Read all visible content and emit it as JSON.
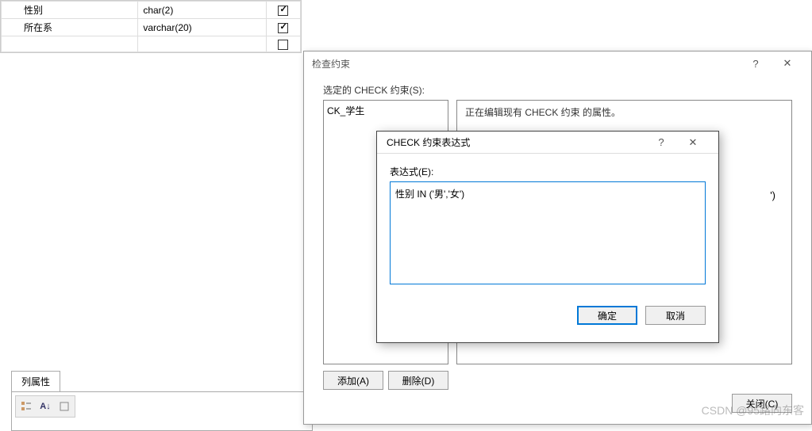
{
  "table": {
    "rows": [
      {
        "name": "性别",
        "type": "char(2)",
        "allowNull": true
      },
      {
        "name": "所在系",
        "type": "varchar(20)",
        "allowNull": true
      },
      {
        "name": "",
        "type": "",
        "allowNull": false
      }
    ]
  },
  "colProps": {
    "tab": "列属性"
  },
  "mainDialog": {
    "title": "检查约束",
    "help": "?",
    "close": "✕",
    "selectedLabel": "选定的 CHECK 约束(S):",
    "listItem": "CK_学生",
    "rightHint": "正在编辑现有 CHECK 约束 的属性。",
    "identityHint": "')",
    "addBtn": "添加(A)",
    "deleteBtn": "删除(D)",
    "closeBtn": "关闭(C)"
  },
  "exprDialog": {
    "title": "CHECK 约束表达式",
    "help": "?",
    "close": "✕",
    "label": "表达式(E):",
    "value": "性别 IN ('男','女')",
    "okBtn": "确定",
    "cancelBtn": "取消"
  },
  "watermark": "CSDN @95路向东客"
}
